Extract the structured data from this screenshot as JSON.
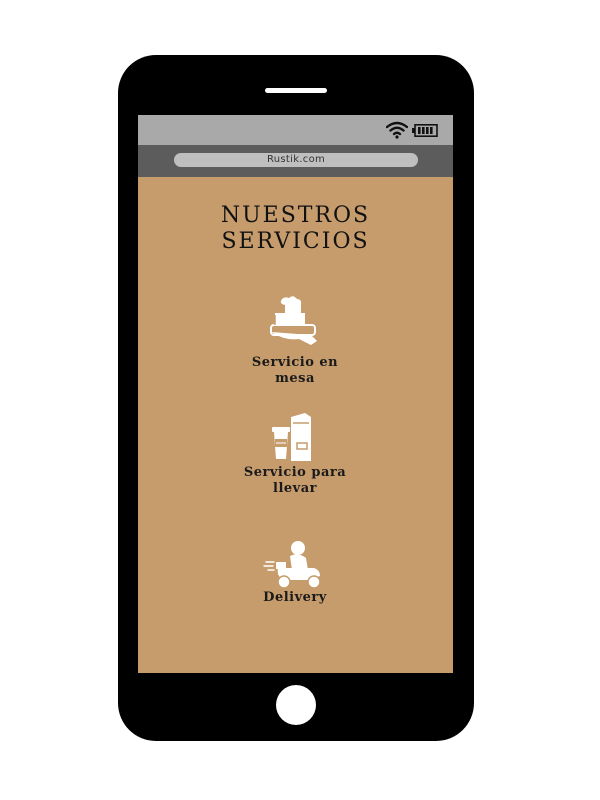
{
  "browser": {
    "url": "Rustik.com"
  },
  "status_bar": {
    "icons": [
      "wifi-icon",
      "battery-icon"
    ]
  },
  "page": {
    "title": "NUESTROS\nSERVICIOS",
    "background_color": "#c69c6d",
    "services": [
      {
        "label": "Servicio en\nmesa",
        "icon": "table-service-icon"
      },
      {
        "label": "Servicio para\nllevar",
        "icon": "takeaway-icon"
      },
      {
        "label": "Delivery",
        "icon": "delivery-scooter-icon"
      }
    ]
  },
  "device": {
    "frame_color": "#000000",
    "home_button": "home-button"
  }
}
